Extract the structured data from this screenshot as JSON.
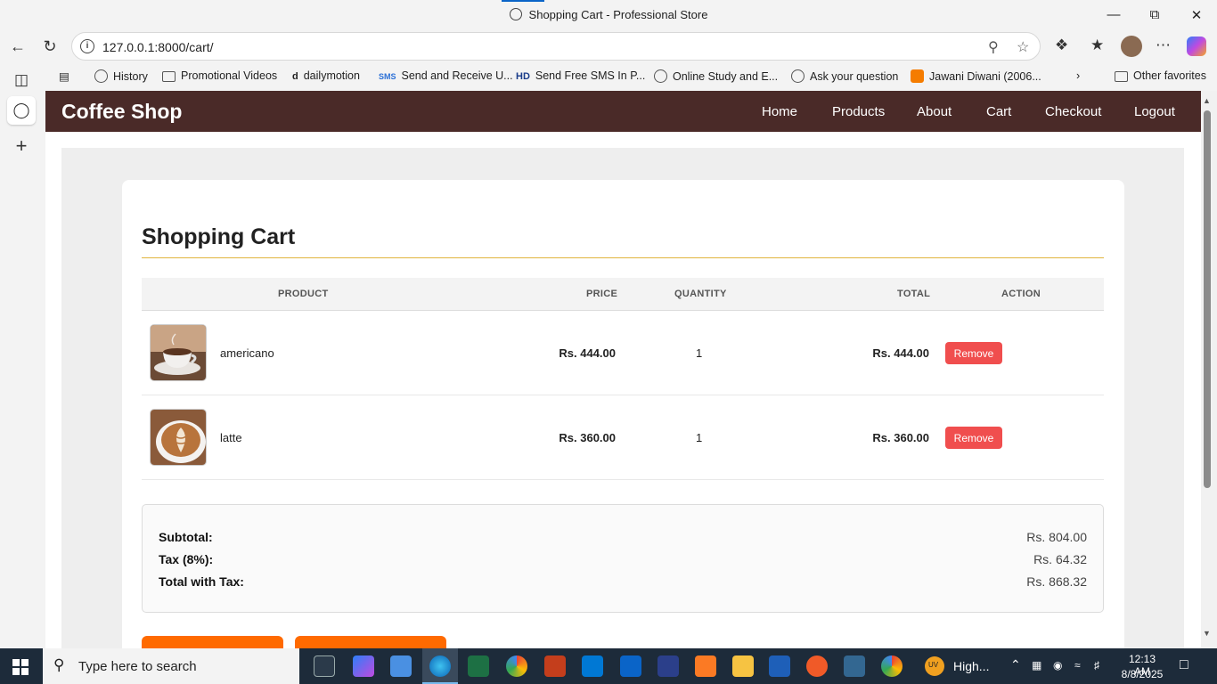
{
  "browser": {
    "window_title": "Shopping Cart - Professional Store",
    "url": "127.0.0.1:8000/cart/",
    "favorites": [
      {
        "label": "History",
        "icon": "globe-icon"
      },
      {
        "label": "Promotional Videos",
        "icon": "folder-icon"
      },
      {
        "label": "dailymotion",
        "icon": "dailymotion-icon"
      },
      {
        "label": "Send and Receive U...",
        "icon": "sms-icon"
      },
      {
        "label": "Send Free SMS In P...",
        "icon": "hd-icon"
      },
      {
        "label": "Online Study and E...",
        "icon": "globe-icon"
      },
      {
        "label": "Ask your question",
        "icon": "globe-icon"
      },
      {
        "label": "Jawani Diwani (2006...",
        "icon": "blogger-icon"
      },
      {
        "label": "Other favorites",
        "icon": "folder-icon"
      }
    ],
    "fav_icon_text": {
      "dailymotion": "d",
      "sms": "SMS",
      "hd": "HD"
    }
  },
  "site": {
    "brand": "Coffee Shop",
    "nav": [
      "Home",
      "Products",
      "About",
      "Cart",
      "Checkout",
      "Logout"
    ]
  },
  "cart": {
    "title": "Shopping Cart",
    "columns": [
      "PRODUCT",
      "PRICE",
      "QUANTITY",
      "TOTAL",
      "ACTION"
    ],
    "items": [
      {
        "name": "americano",
        "price": "Rs. 444.00",
        "quantity": "1",
        "total": "Rs. 444.00",
        "action": "Remove"
      },
      {
        "name": "latte",
        "price": "Rs. 360.00",
        "quantity": "1",
        "total": "Rs. 360.00",
        "action": "Remove"
      }
    ],
    "summary": {
      "subtotal_label": "Subtotal:",
      "subtotal": "Rs. 804.00",
      "tax_label": "Tax (8%):",
      "tax": "Rs. 64.32",
      "grand_label": "Total with Tax:",
      "grand": "Rs. 868.32"
    }
  },
  "taskbar": {
    "search_placeholder": "Type here to search",
    "weather_badge": "UV",
    "weather_text": "High...",
    "time": "12:13 AM",
    "date": "8/8/2025"
  },
  "colors": {
    "site_nav": "#4a2a28",
    "title_rule": "#e0b53e",
    "remove_button": "#f04e4e",
    "orange_button": "#ff6a00"
  }
}
